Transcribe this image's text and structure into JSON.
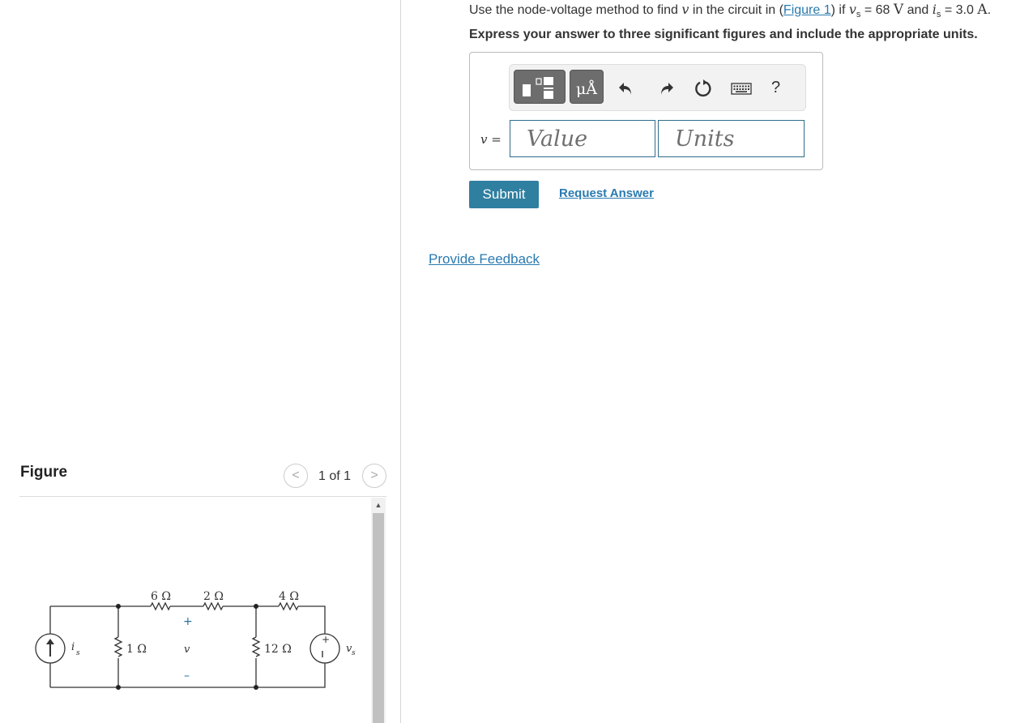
{
  "problem": {
    "prefix": "Use the node-voltage method to find ",
    "var_v": "v",
    "mid1": " in the circuit in (",
    "figure_link": "Figure 1",
    "mid2": ") if ",
    "var_vs": "v",
    "sub_s1": "s",
    "eq1": " = 68 ",
    "unit_V": "V",
    "and": " and ",
    "var_is": "i",
    "sub_s2": "s",
    "eq2": " = 3.0 ",
    "unit_A": "A",
    "period": ".",
    "instruction": "Express your answer to three significant figures and include the appropriate units."
  },
  "toolbar": {
    "units_symbol": "μÅ",
    "help": "?",
    "icons": [
      "templates-icon",
      "units-icon",
      "undo-icon",
      "redo-icon",
      "reset-icon",
      "keyboard-icon",
      "help-icon"
    ]
  },
  "answer": {
    "label": "v =",
    "value_placeholder": "Value",
    "units_placeholder": "Units",
    "value": "",
    "units": ""
  },
  "actions": {
    "submit": "Submit",
    "request_answer": "Request Answer",
    "provide_feedback": "Provide Feedback"
  },
  "figure": {
    "title": "Figure",
    "count": "1 of 1",
    "prev": "<",
    "next": ">",
    "circuit": {
      "r1": "6 Ω",
      "r2": "2 Ω",
      "r3": "4 Ω",
      "r4": "1 Ω",
      "r5": "12 Ω",
      "is_label": "i",
      "is_sub": "s",
      "vs_label": "v",
      "vs_sub": "s",
      "v_label": "v",
      "plus": "+",
      "minus": "–"
    }
  },
  "colors": {
    "accent": "#2f7fa0",
    "link": "#2a7ab0",
    "input_border": "#2f6d8a",
    "toolbar_button": "#6d6d6d"
  }
}
